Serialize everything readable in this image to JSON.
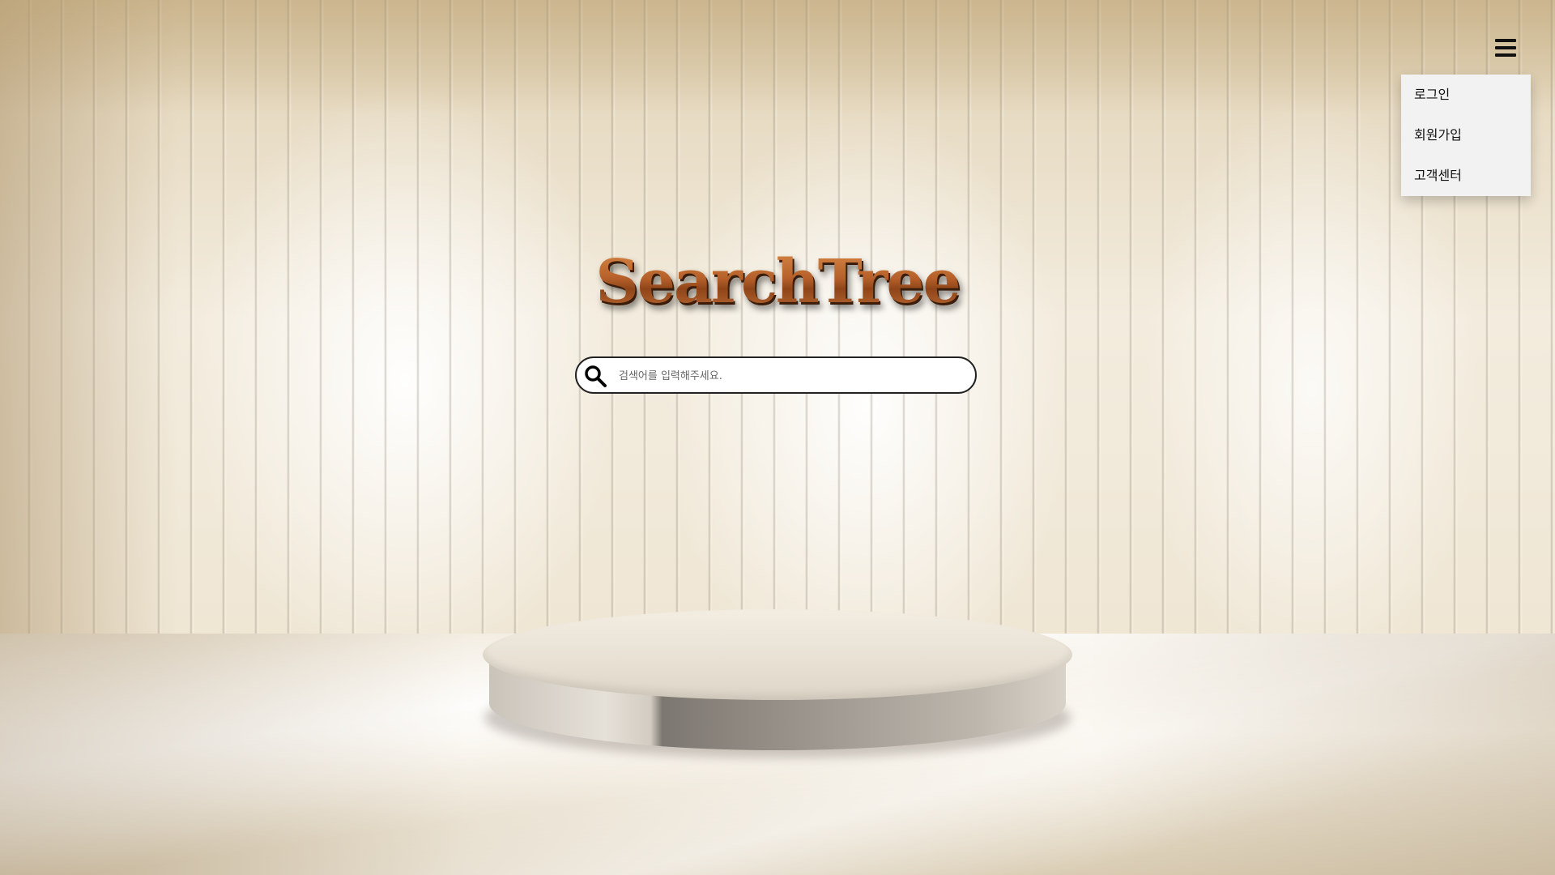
{
  "menu": {
    "icon": "hamburger-menu-icon",
    "items": [
      {
        "label": "로그인"
      },
      {
        "label": "회원가입"
      },
      {
        "label": "고객센터"
      }
    ]
  },
  "logo": {
    "text": "SearchTree"
  },
  "search": {
    "icon": "search-icon",
    "placeholder": "검색어를 입력해주세요.",
    "value": ""
  },
  "colors": {
    "logo": "#b5672e",
    "dropdown_bg": "#f2f2f2",
    "search_border": "#222222"
  }
}
